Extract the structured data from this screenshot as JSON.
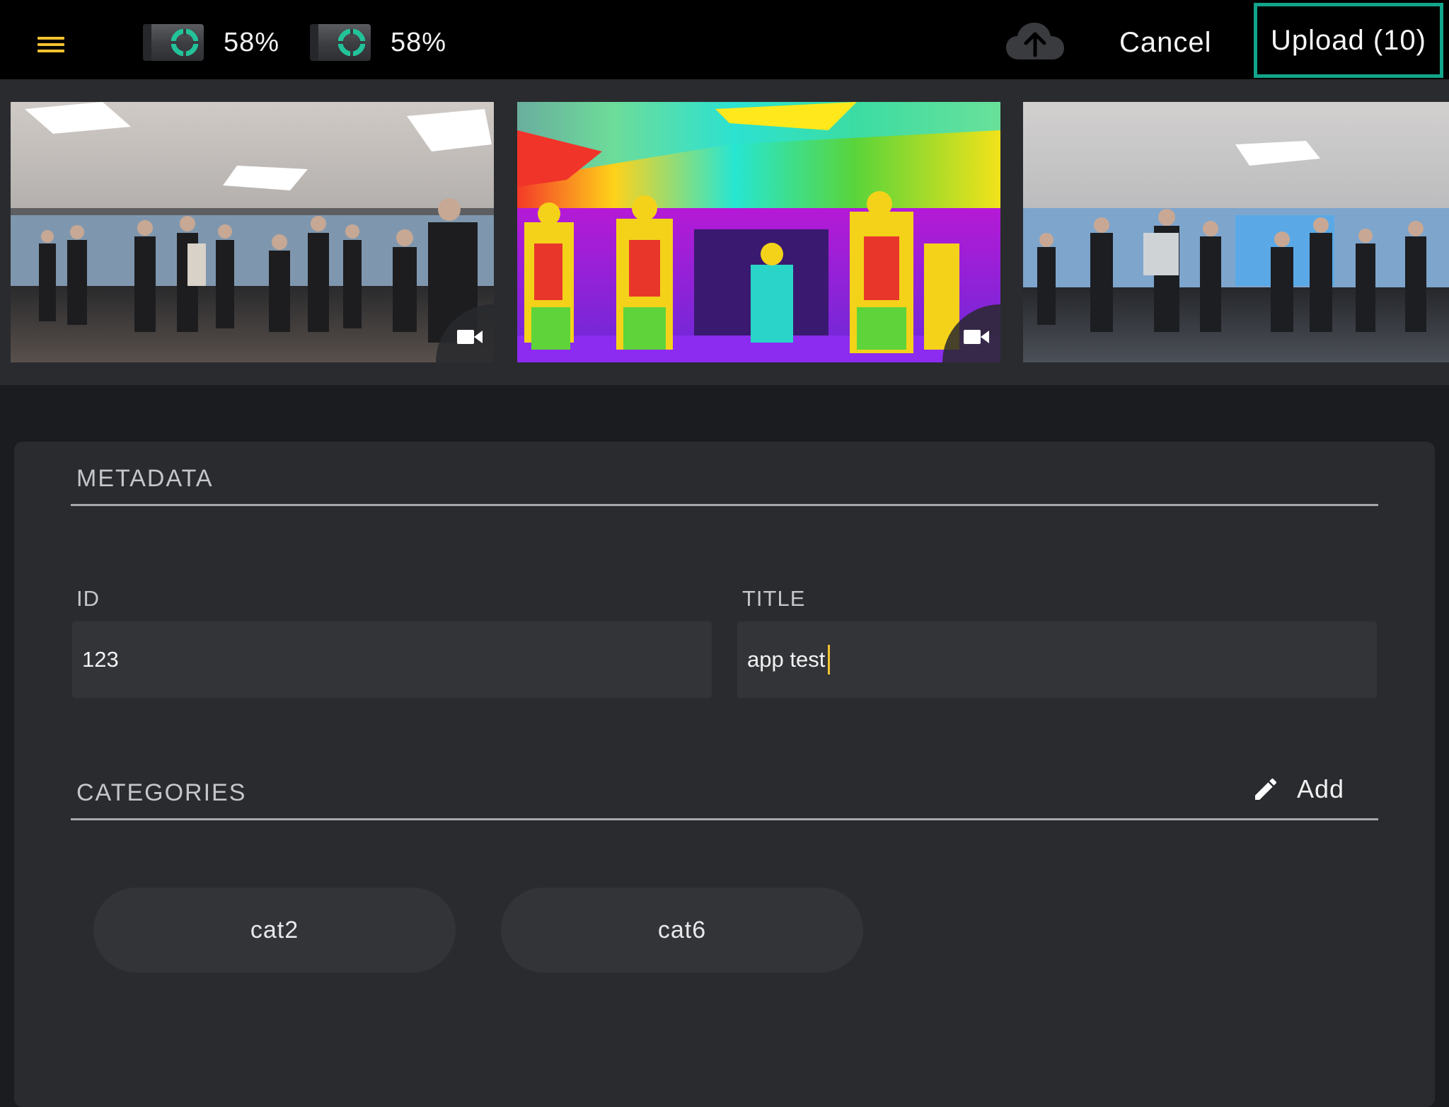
{
  "colors": {
    "accent_yellow": "#f2c230",
    "upload_border": "#13a58b",
    "camera_ring": "#23c39a"
  },
  "topbar": {
    "menu_icon": "hamburger-menu-icon",
    "cameras": [
      {
        "icon": "camera-battery-icon",
        "percent": "58%"
      },
      {
        "icon": "camera-battery-icon",
        "percent": "58%"
      }
    ],
    "cloud_icon": "cloud-upload-icon",
    "cancel_label": "Cancel",
    "upload_label": "Upload (10)"
  },
  "thumbnails": [
    {
      "kind": "office-photo",
      "badge_icon": "video-camera-icon"
    },
    {
      "kind": "thermal-photo",
      "badge_icon": "video-camera-icon"
    },
    {
      "kind": "office-photo"
    }
  ],
  "metadata": {
    "section_title": "METADATA",
    "id_label": "ID",
    "id_value": "123",
    "title_label": "TITLE",
    "title_value": "app test"
  },
  "categories": {
    "section_title": "CATEGORIES",
    "add_icon": "pencil-icon",
    "add_label": "Add",
    "items": [
      "cat2",
      "cat6"
    ]
  }
}
